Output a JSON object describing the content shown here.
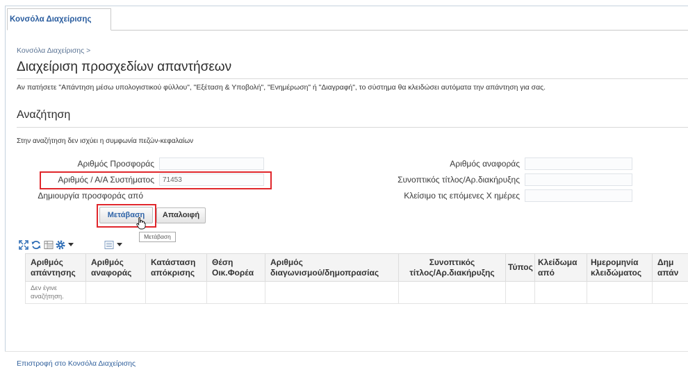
{
  "tabs": [
    {
      "label": "Κονσόλα Διαχείρισης"
    }
  ],
  "breadcrumb": {
    "item": "Κονσόλα Διαχείρισης",
    "separator": ">"
  },
  "page_title": "Διαχείριση προσχεδίων απαντήσεων",
  "instruction": "Αν πατήσετε \"Απάντηση μέσω υπολογιστικού φύλλου\", \"Εξέταση & Υποβολή\", \"Ενημέρωση\" ή \"Διαγραφή\", το σύστημα θα κλειδώσει αυτόματα την απάντηση για σας.",
  "search": {
    "heading": "Αναζήτηση",
    "note": "Στην αναζήτηση δεν ισχύει η συμφωνία πεζών-κεφαλαίων",
    "fields_left": [
      {
        "label": "Αριθμός Προσφοράς",
        "value": ""
      },
      {
        "label": "Αριθμός / Α/Α Συστήματος",
        "value": "71453"
      },
      {
        "label": "Δημιουργία προσφοράς από"
      }
    ],
    "fields_right": [
      {
        "label": "Αριθμός αναφοράς",
        "value": ""
      },
      {
        "label": "Συνοπτικός τίτλος/Αρ.διακήρυξης",
        "value": ""
      },
      {
        "label": "Κλείσιμο τις επόμενες Χ ημέρες",
        "value": ""
      }
    ],
    "go_button": "Μετάβαση",
    "clear_button": "Απαλοιφή",
    "tooltip": "Μετάβαση"
  },
  "toolbar": {
    "icons": [
      "detach-icon",
      "refresh-icon",
      "freeze-icon",
      "settings-gear-icon",
      "view-icon"
    ]
  },
  "table": {
    "columns": [
      {
        "l1": "Αριθμός",
        "l2": "απάντησης"
      },
      {
        "l1": "Αριθμός",
        "l2": "αναφοράς"
      },
      {
        "l1": "Κατάσταση",
        "l2": "απόκρισης"
      },
      {
        "l1": "Θέση",
        "l2": "Οικ.Φορέα"
      },
      {
        "l1": "Αριθμός",
        "l2": "διαγωνισμού/δημοπρασίας"
      },
      {
        "l1": "Συνοπτικός",
        "l2": "τίτλος/Αρ.διακήρυξης"
      },
      {
        "l1": "Τύπος"
      },
      {
        "l1": "Κλείδωμα",
        "l2": "από"
      },
      {
        "l1": "Ημερομηνία",
        "l2": "κλειδώματος"
      },
      {
        "l1": "Δημ",
        "l2": "απάν"
      }
    ],
    "empty_message": "Δεν έγινε αναζήτηση."
  },
  "footer_link": "Επιστροφή στο Κονσόλα Διαχείρισης",
  "colors": {
    "link": "#2f5f9b",
    "tab_text": "#2a5d9f",
    "highlight_box": "#e0262b",
    "icon_blue": "#2d6cb5"
  }
}
